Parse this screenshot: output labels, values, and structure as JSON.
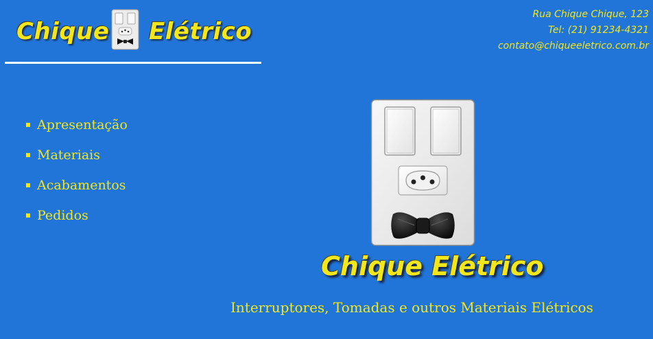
{
  "header": {
    "logo_left": "Chique",
    "logo_right": "Elétrico",
    "contact": {
      "address": "Rua Chique Chique, 123",
      "phone": "Tel: (21) 91234-4321",
      "email": "contato@chiqueeletrico.com.br"
    }
  },
  "nav": {
    "items": [
      {
        "label": "Apresentação"
      },
      {
        "label": "Materiais"
      },
      {
        "label": "Acabamentos"
      },
      {
        "label": "Pedidos"
      }
    ]
  },
  "hero": {
    "title": "Chique  Elétrico",
    "tagline": "Interruptores, Tomadas e outros Materiais Elétricos"
  },
  "colors": {
    "background": "#2175d9",
    "accent_yellow": "#f2e71d",
    "plate_white": "#ececec",
    "rule_white": "#ffffff"
  },
  "icons": {
    "logo_plate": "switch-plate-bowtie-icon",
    "hero_plate": "switch-plate-bowtie-icon",
    "nav_bullet": "square-bullet-icon"
  }
}
